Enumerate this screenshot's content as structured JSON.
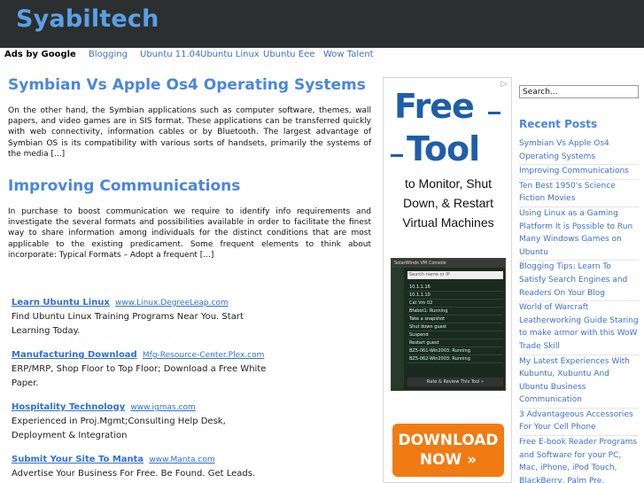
{
  "header": {
    "site_title": "Syabiltech"
  },
  "adbar": {
    "ads_by": "Ads by Google",
    "links": [
      "Blogging",
      "Ubuntu 11.04",
      "Ubuntu Linux",
      "Ubuntu Eee",
      "Wow Talent"
    ]
  },
  "posts": [
    {
      "title": "Symbian Vs Apple Os4 Operating Systems",
      "excerpt": "On the other hand, the Symbian applications such as computer software, themes, wall papers, and video games are in SIS format. These applications can be transferred quickly with web connectivity, information cables or by Bluetooth. The largest advantage of Symbian OS is its compatibility with various sorts of handsets, primarily the systems of the media [...]"
    },
    {
      "title": "Improving Communications",
      "excerpt": "In purchase to boost communication we require to identify info requirements and investigate the several formats and possibilities available in order to facilitate the finest way to share information among individuals for the distinct conditions that are most applicable to the existing predicament. Some frequent elements to think about incorporate: Typical Formats – Adopt a frequent [...]"
    }
  ],
  "ads": [
    {
      "title": "Learn Ubuntu Linux",
      "url": "www.Linux.DegreeLeap.com",
      "desc": "Find Ubuntu Linux Training Programs Near You. Start Learning Today."
    },
    {
      "title": "Manufacturing Download",
      "url": "Mfg-Resource-Center.Plex.com",
      "desc": "ERP/MRP, Shop Floor to Top Floor; Download a Free White Paper."
    },
    {
      "title": "Hospitality Technology",
      "url": "www.igmas.com",
      "desc": "Experienced in Proj.Mgmt;Consulting Help Desk, Deployment & Integration"
    },
    {
      "title": "Submit Your Site To Manta",
      "url": "www.Manta.com",
      "desc": "Advertise Your Business For Free. Be Found. Get Leads."
    }
  ],
  "banner": {
    "free": "Free",
    "tool": "Tool",
    "copy": "to Monitor, Shut Down, & Restart Virtual Machines",
    "console_title": "SolarWinds VM Console",
    "console_search": "Search name or IP",
    "console_rows": [
      "10.1.1.16",
      "10.1.1.10",
      "Cat Vm 02",
      "Bfabot1: Running",
      "Take a snapshot",
      "Shut down guest",
      "Suspend",
      "Restart guest",
      "BZ5-061-Win2003: Running",
      "BZ5-062-Win2003: Running"
    ],
    "console_footer": "Rate & Review This Tool »",
    "download": "DOWNLOAD NOW »"
  },
  "sidebar": {
    "search_value": "Search...",
    "recent_title": "Recent Posts",
    "recent": [
      "Symbian Vs Apple Os4 Operating Systems",
      "Improving Communications",
      "Ten Best 1950's Science Fiction Movies",
      "Using Linux as a Gaming Platform It is Possible to Run Many Windows Games on Ubuntu",
      "Blogging Tips: Learn To Satisfy Search Engines and Readers On Your Blog",
      "World of Warcraft Leatherworking Guide Staring to make armor with this WoW Trade Skill",
      "My Latest Experiences With Kubuntu, Xubuntu And Ubuntu Business Communication",
      "3 Advantageous Accessories For Your Cell Phone",
      "Free E-book Reader Programs and Software for your PC, Mac, iPhone, iPod Touch, BlackBerry, Palm Pre, Symbian Smartphones, and"
    ]
  }
}
